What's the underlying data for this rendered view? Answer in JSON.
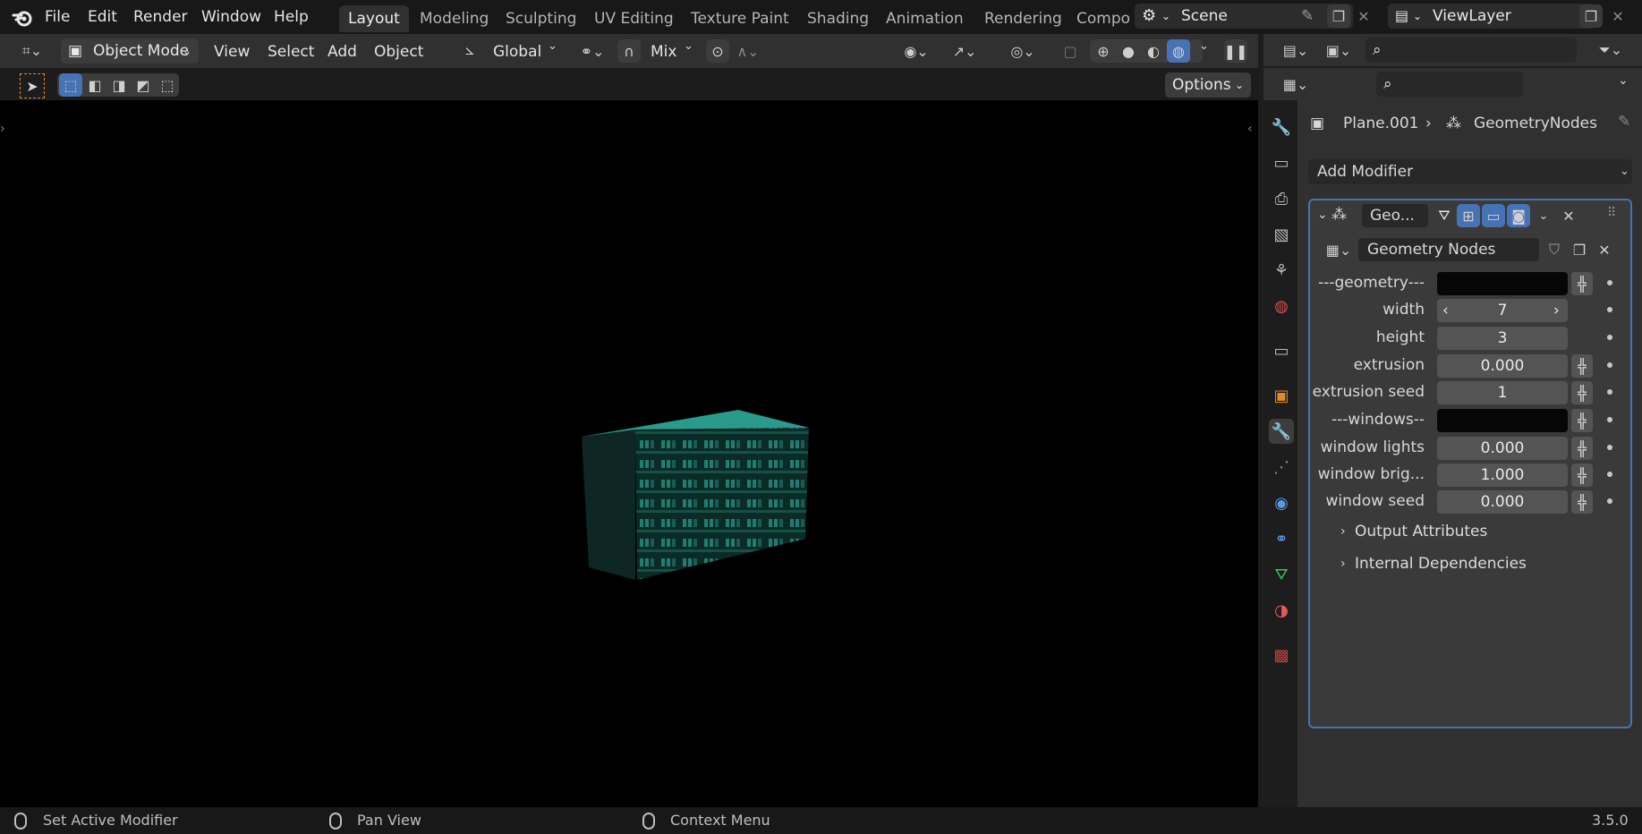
{
  "menubar": {
    "items": [
      "File",
      "Edit",
      "Render",
      "Window",
      "Help"
    ],
    "workspaces": [
      "Layout",
      "Modeling",
      "Sculpting",
      "UV Editing",
      "Texture Paint",
      "Shading",
      "Animation",
      "Rendering",
      "Compo"
    ],
    "active_workspace": "Layout",
    "scene": "Scene",
    "view_layer": "ViewLayer"
  },
  "viewport_header": {
    "mode": "Object Mode",
    "menus": [
      "View",
      "Select",
      "Add",
      "Object"
    ],
    "orientation": "Global",
    "snap": "Mix",
    "options": "Options"
  },
  "properties": {
    "breadcrumb_object": "Plane.001",
    "breadcrumb_modifier": "GeometryNodes",
    "add_modifier": "Add Modifier",
    "modifier_name": "Geo...",
    "node_group": "Geometry Nodes",
    "inputs": [
      {
        "label": "---geometry---",
        "value": ""
      },
      {
        "label": "width",
        "value": "7"
      },
      {
        "label": "height",
        "value": "3"
      },
      {
        "label": "extrusion",
        "value": "0.000"
      },
      {
        "label": "extrusion seed",
        "value": "1"
      },
      {
        "label": "---windows--",
        "value": ""
      },
      {
        "label": "window lights",
        "value": "0.000"
      },
      {
        "label": "window brig...",
        "value": "1.000"
      },
      {
        "label": "window seed",
        "value": "0.000"
      }
    ],
    "sections": [
      "Output Attributes",
      "Internal Dependencies"
    ]
  },
  "statusbar": {
    "left_action": "Set Active Modifier",
    "middle_action": "Pan View",
    "right_action": "Context Menu",
    "version": "3.5.0"
  },
  "colors": {
    "accent": "#4772b3",
    "building": "#2aa898"
  }
}
